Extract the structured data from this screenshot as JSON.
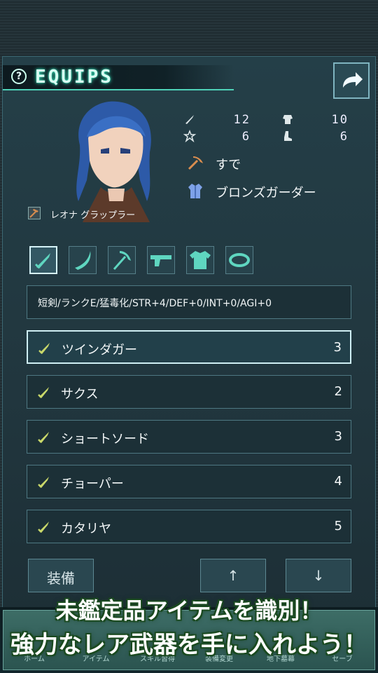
{
  "header": {
    "title": "EQUIPS",
    "help_icon": "question-circle-icon",
    "back_icon": "share-arrow-icon"
  },
  "character": {
    "name": "レオナ グラップラー",
    "stats": [
      {
        "icon": "sword-stat-icon",
        "value": "12"
      },
      {
        "icon": "armor-stat-icon",
        "value": "10"
      },
      {
        "icon": "star-stat-icon",
        "value": "6"
      },
      {
        "icon": "boot-stat-icon",
        "value": "6"
      }
    ],
    "weapon": "すで",
    "armor": "ブロンズガーダー"
  },
  "tabs": [
    {
      "name": "dagger",
      "icon": "dagger-icon"
    },
    {
      "name": "sword",
      "icon": "scimitar-icon"
    },
    {
      "name": "hammer",
      "icon": "hammer-icon"
    },
    {
      "name": "gun",
      "icon": "gun-icon"
    },
    {
      "name": "armor",
      "icon": "shirt-icon"
    },
    {
      "name": "ring",
      "icon": "ring-icon"
    }
  ],
  "description": "短剣/ランクE/猛毒化/STR+4/DEF+0/INT+0/AGI+0",
  "items": [
    {
      "name": "ツインダガー",
      "count": "3"
    },
    {
      "name": "サクス",
      "count": "2"
    },
    {
      "name": "ショートソード",
      "count": "3"
    },
    {
      "name": "チョーパー",
      "count": "4"
    },
    {
      "name": "カタリヤ",
      "count": "5"
    }
  ],
  "buttons": {
    "equip": "装備",
    "up": "↑",
    "down": "↓"
  },
  "nav": [
    "ホーム",
    "アイテム",
    "スキル習得",
    "装備変更",
    "地下墓幕",
    "セーブ"
  ],
  "promo": {
    "line1": "未鑑定品アイテムを識別！",
    "line2": "強力なレア武器を手に入れよう！"
  },
  "colors": {
    "accent": "#4fd2b8",
    "panel": "#243f48",
    "item_icon": "#c9d86a"
  }
}
